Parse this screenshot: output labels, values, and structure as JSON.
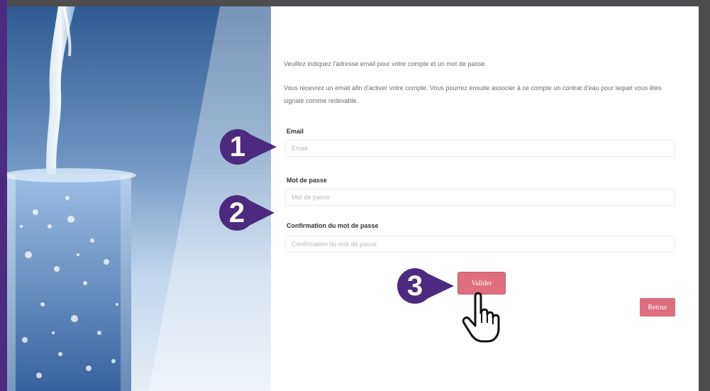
{
  "colors": {
    "purple": "#4b2a7f",
    "accent_button": "#dd6f7f",
    "frame": "#4d4d4f"
  },
  "form": {
    "intro_line1": "Veuillez indiquez l'adresse email pour votre compte et un mot de passe.",
    "intro_line2": "Vous recevrez un email afin d'activer votre compte. Vous pourrez ensuite associer à ce compte un contrat d'eau pour lequel vous êtes signalé comme redevable.",
    "email": {
      "label": "Email",
      "placeholder": "Email",
      "value": ""
    },
    "password": {
      "label": "Mot de passe",
      "placeholder": "Mot de passe",
      "value": ""
    },
    "confirm": {
      "label": "Confirmation du mot de passe",
      "placeholder": "Confirmation du mot de passe",
      "value": ""
    },
    "validate_label": "Valider",
    "back_label": "Retour"
  },
  "callouts": [
    {
      "number": "1"
    },
    {
      "number": "2"
    },
    {
      "number": "3"
    }
  ],
  "icons": {
    "cursor": "hand-pointer-icon",
    "photo": "water-glass-photo"
  }
}
